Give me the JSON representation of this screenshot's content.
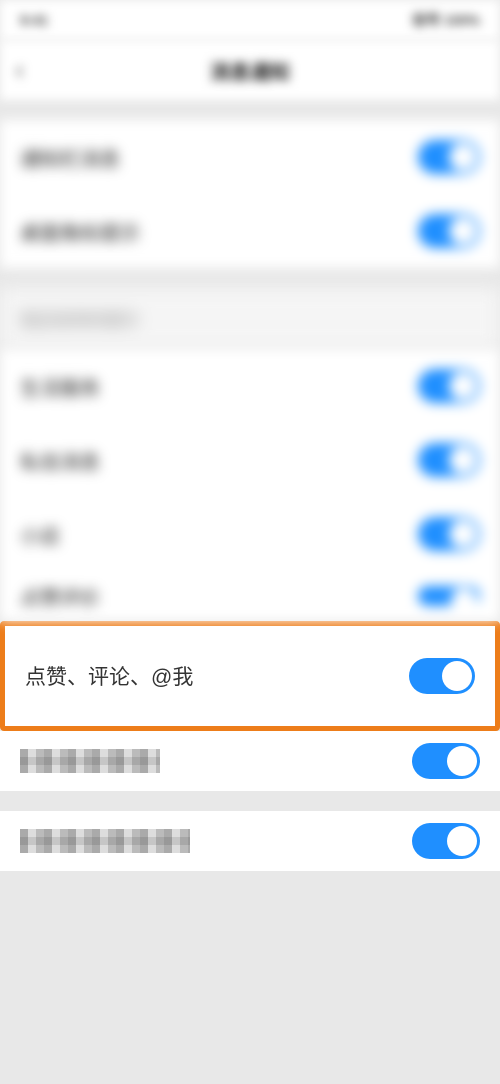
{
  "status": {
    "time": "9:41",
    "right": "信号 100%"
  },
  "nav": {
    "title": "消息通知"
  },
  "section1": {
    "items": [
      {
        "label": "通知栏消息",
        "on": true
      },
      {
        "label": "桌面角标提示",
        "on": true
      }
    ]
  },
  "section2_header": "我还收到的提示",
  "section2": {
    "items": [
      {
        "label": "生活服务",
        "on": true
      },
      {
        "label": "私信消息",
        "on": true
      },
      {
        "label": "小店",
        "on": true
      },
      {
        "label": "点赞评价",
        "on": true
      }
    ]
  },
  "highlight": {
    "label": "点赞、评论、@我",
    "on": true
  },
  "pixel_rows": [
    {
      "label": "新增粉丝",
      "on": true
    },
    {
      "label": "搜索推荐",
      "on": true
    }
  ]
}
